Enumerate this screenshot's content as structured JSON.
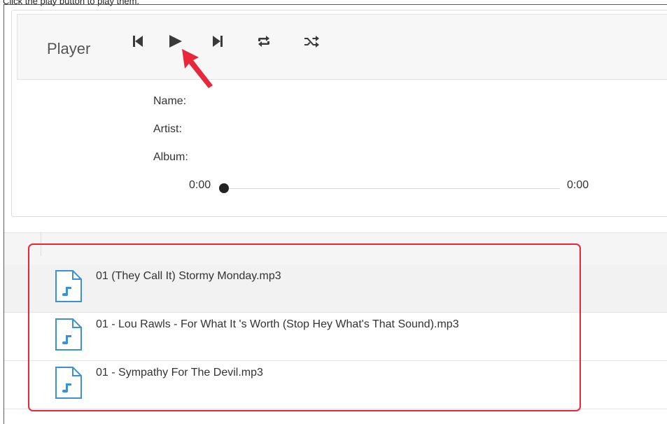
{
  "instruction": "Click the play button to play them.",
  "player": {
    "title": "Player",
    "controls": [
      {
        "name": "previous-icon",
        "label": "previous"
      },
      {
        "name": "play-icon",
        "label": "play"
      },
      {
        "name": "next-icon",
        "label": "next"
      },
      {
        "name": "repeat-icon",
        "label": "repeat"
      },
      {
        "name": "shuffle-icon",
        "label": "shuffle"
      }
    ],
    "name_label": "Name:",
    "artist_label": "Artist:",
    "album_label": "Album:",
    "current_time": "0:00",
    "total_time": "0:00",
    "progress": 0
  },
  "playlist": {
    "files": [
      {
        "label": "01 (They Call It) Stormy Monday.mp3"
      },
      {
        "label": "01 - Lou Rawls - For What It 's Worth (Stop Hey What's That Sound).mp3"
      },
      {
        "label": "01 - Sympathy For The Devil.mp3"
      }
    ]
  },
  "colors": {
    "annotation": "#e8283a",
    "file_icon": "#3d8fd6",
    "control_icon": "#3a3a3a"
  }
}
